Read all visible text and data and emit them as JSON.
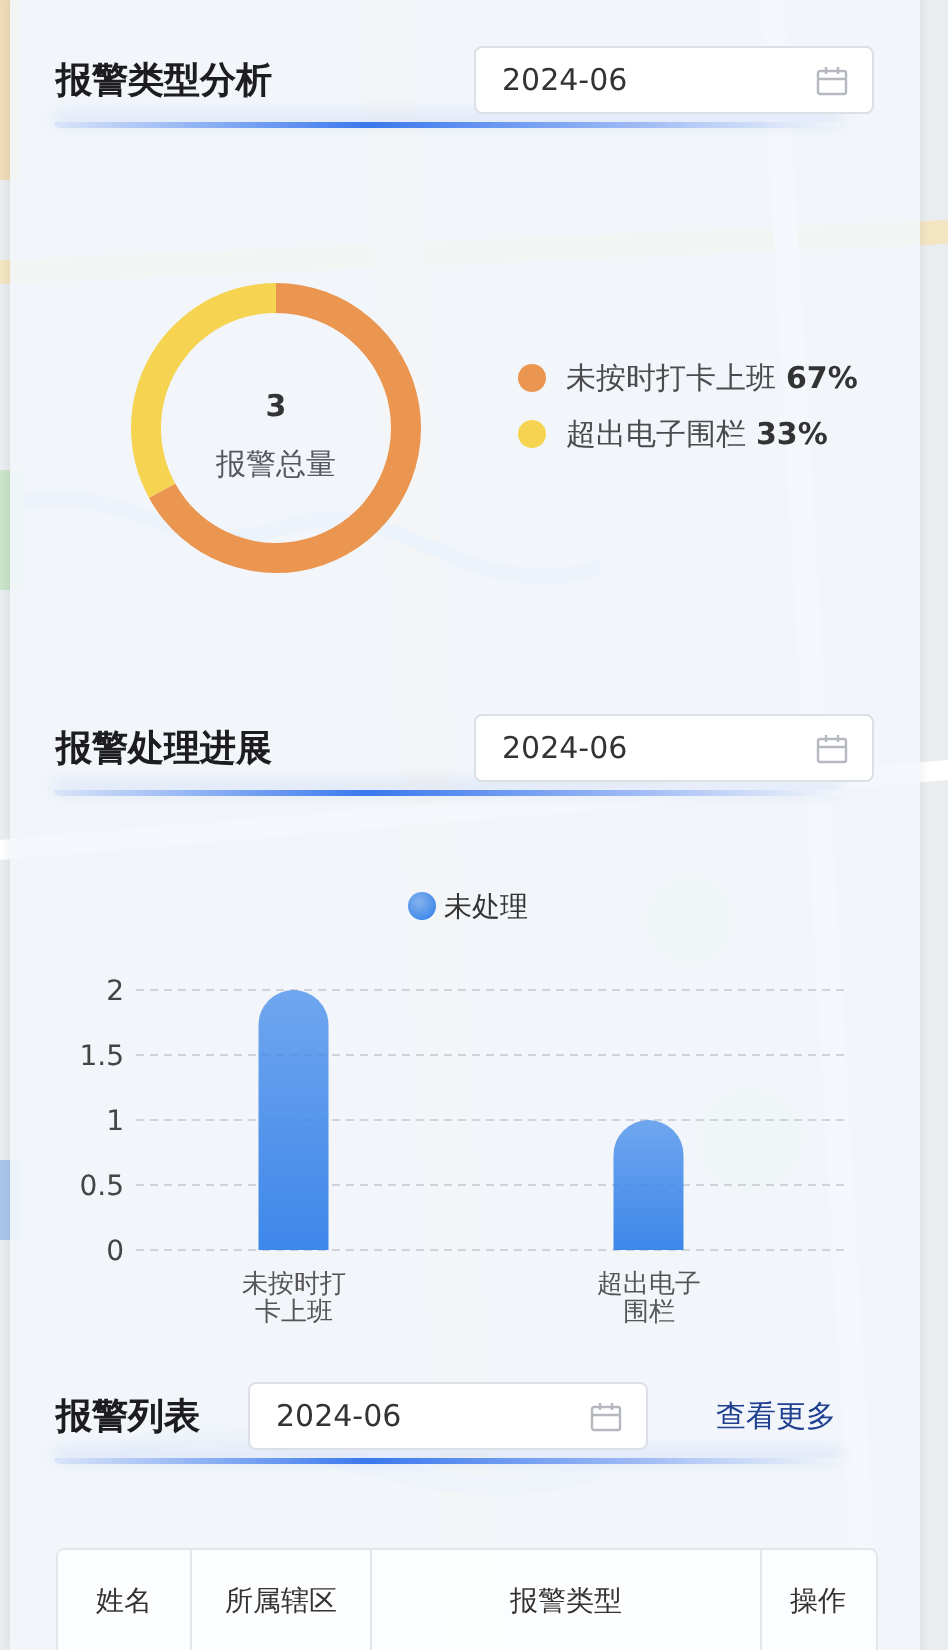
{
  "type_analysis": {
    "title": "报警类型分析",
    "date": "2024-06",
    "total": "3",
    "total_label": "报警总量",
    "legend": [
      {
        "percent": "67%",
        "color": "#eb9650"
      },
      {
        "percent": "33%",
        "color": "#f6d452"
      }
    ],
    "chart_data": {
      "type": "donut",
      "categories": [
        "未按时打卡上班",
        "超出电子围栏"
      ],
      "values": [
        67,
        33
      ]
    }
  },
  "progress": {
    "title": "报警处理进展",
    "date": "2024-06",
    "chart_data": {
      "type": "bar",
      "categories": [
        "未按时打卡上班",
        "超出电子围栏"
      ],
      "series": [
        {
          "name": "未处理",
          "color": "#3d87ea",
          "values": [
            2,
            1
          ]
        }
      ],
      "ylim": [
        0,
        2
      ],
      "yticks": [
        0,
        0.5,
        1,
        1.5,
        2
      ],
      "grid": true
    }
  },
  "alarm_list": {
    "title": "报警列表",
    "date": "2024-06",
    "more_link": "查看更多",
    "table": {
      "columns": [
        "姓名",
        "所属辖区",
        "报警类型",
        "操作"
      ]
    }
  }
}
